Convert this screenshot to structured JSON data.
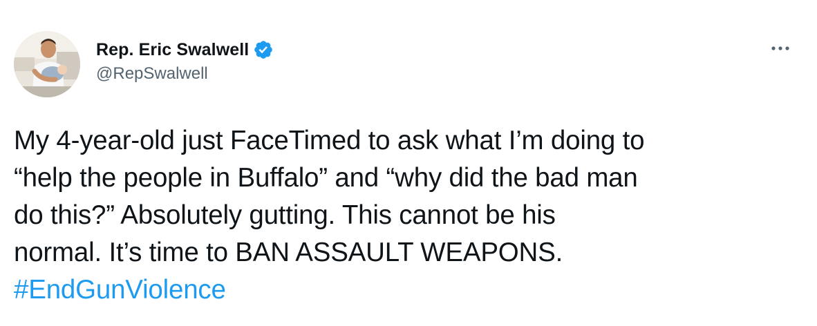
{
  "author": {
    "display_name": "Rep. Eric Swalwell",
    "handle": "@RepSwalwell",
    "verified": true,
    "avatar_icon": "profile-photo"
  },
  "tweet": {
    "lines": [
      "My 4-year-old just FaceTimed to ask what I’m doing to",
      "“help the people in Buffalo” and “why did the bad man",
      "do this?” Absolutely gutting. This cannot be his",
      "normal. It’s time to BAN ASSAULT WEAPONS."
    ],
    "hashtag": "#EndGunViolence"
  },
  "icons": {
    "verified": "verified-badge-icon",
    "more": "more-options-icon"
  },
  "colors": {
    "text": "#0f1419",
    "secondary": "#536471",
    "accent": "#1d9bf0"
  }
}
